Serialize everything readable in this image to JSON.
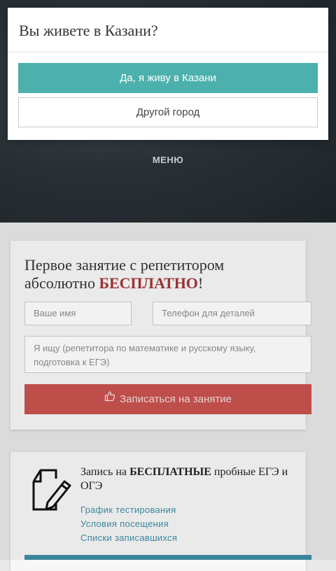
{
  "header": {
    "menu_label": "МЕНЮ"
  },
  "lead_form": {
    "title_part1": "Первое занятие с репетитором абсолютно ",
    "title_accent": "БЕСПЛАТНО",
    "title_end": "!",
    "name_placeholder": "Ваше имя",
    "phone_placeholder": "Телефон для деталей",
    "query_placeholder": "Я ищу (репетитора по математике и русскому языку, подготовка к ЕГЭ)",
    "submit_label": "Записаться на занятие",
    "accent_color": "#a43535",
    "button_color": "#c9534f"
  },
  "exam_card": {
    "title_part1": "Запись на ",
    "title_strong": "БЕСПЛАТНЫЕ",
    "title_part2": " пробные ЕГЭ и ОГЭ",
    "links": [
      "График тестирования",
      "Условия посещения",
      "Списки записавшихся"
    ],
    "link_color": "#3d8ea6"
  },
  "city_dialog": {
    "question": "Вы живете в Казани?",
    "confirm_label": "Да, я живу в Казани",
    "other_label": "Другой город",
    "confirm_color": "#4cb1ad"
  }
}
